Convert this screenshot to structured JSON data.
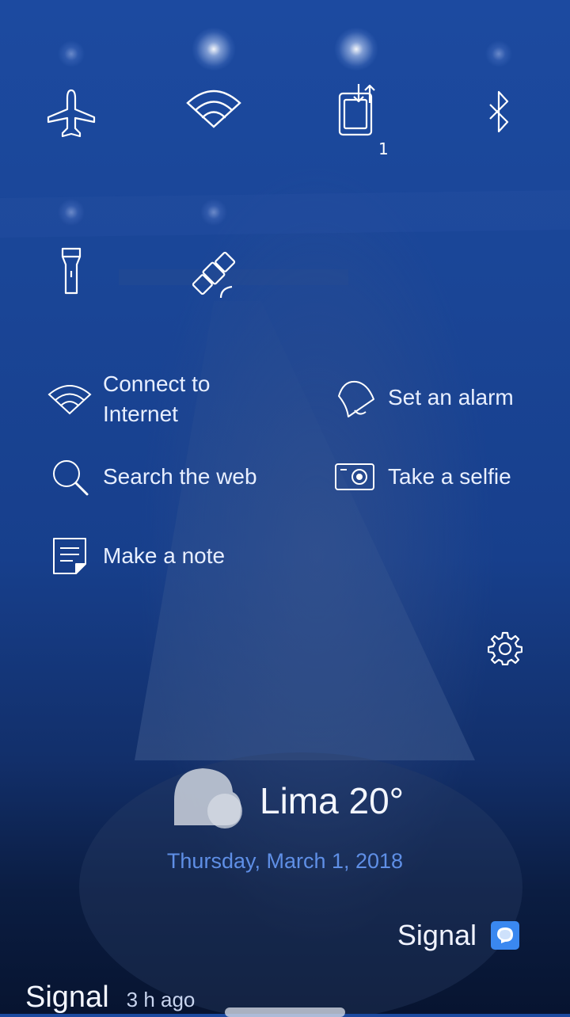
{
  "quick_toggles": [
    {
      "name": "airplane-mode",
      "icon": "airplane-icon",
      "active": false
    },
    {
      "name": "wifi",
      "icon": "wifi-icon",
      "active": true
    },
    {
      "name": "data-transfer",
      "icon": "transfer-icon",
      "active": true,
      "count": "1"
    },
    {
      "name": "bluetooth",
      "icon": "bluetooth-icon",
      "active": false
    },
    {
      "name": "flashlight",
      "icon": "flashlight-icon",
      "active": false
    },
    {
      "name": "location",
      "icon": "satellite-icon",
      "active": false
    }
  ],
  "shortcuts": {
    "connect_internet": "Connect to\nInternet",
    "set_alarm": "Set an alarm",
    "search_web": "Search the web",
    "take_selfie": "Take a selfie",
    "make_note": "Make a note"
  },
  "settings_icon": "gear-icon",
  "weather": {
    "city_temp": "Lima 20°",
    "icon": "cloud-icon"
  },
  "date": "Thursday, March 1, 2018",
  "notification": {
    "app_name": "Signal",
    "icon": "signal-chat-icon",
    "accent": "#3a88f0"
  },
  "bottom_item": {
    "app_name": "Signal",
    "time": "3 h ago"
  },
  "colors": {
    "background_top": "#1c4aa0",
    "background_bottom": "#071430",
    "date_color": "#5f8fe6"
  }
}
